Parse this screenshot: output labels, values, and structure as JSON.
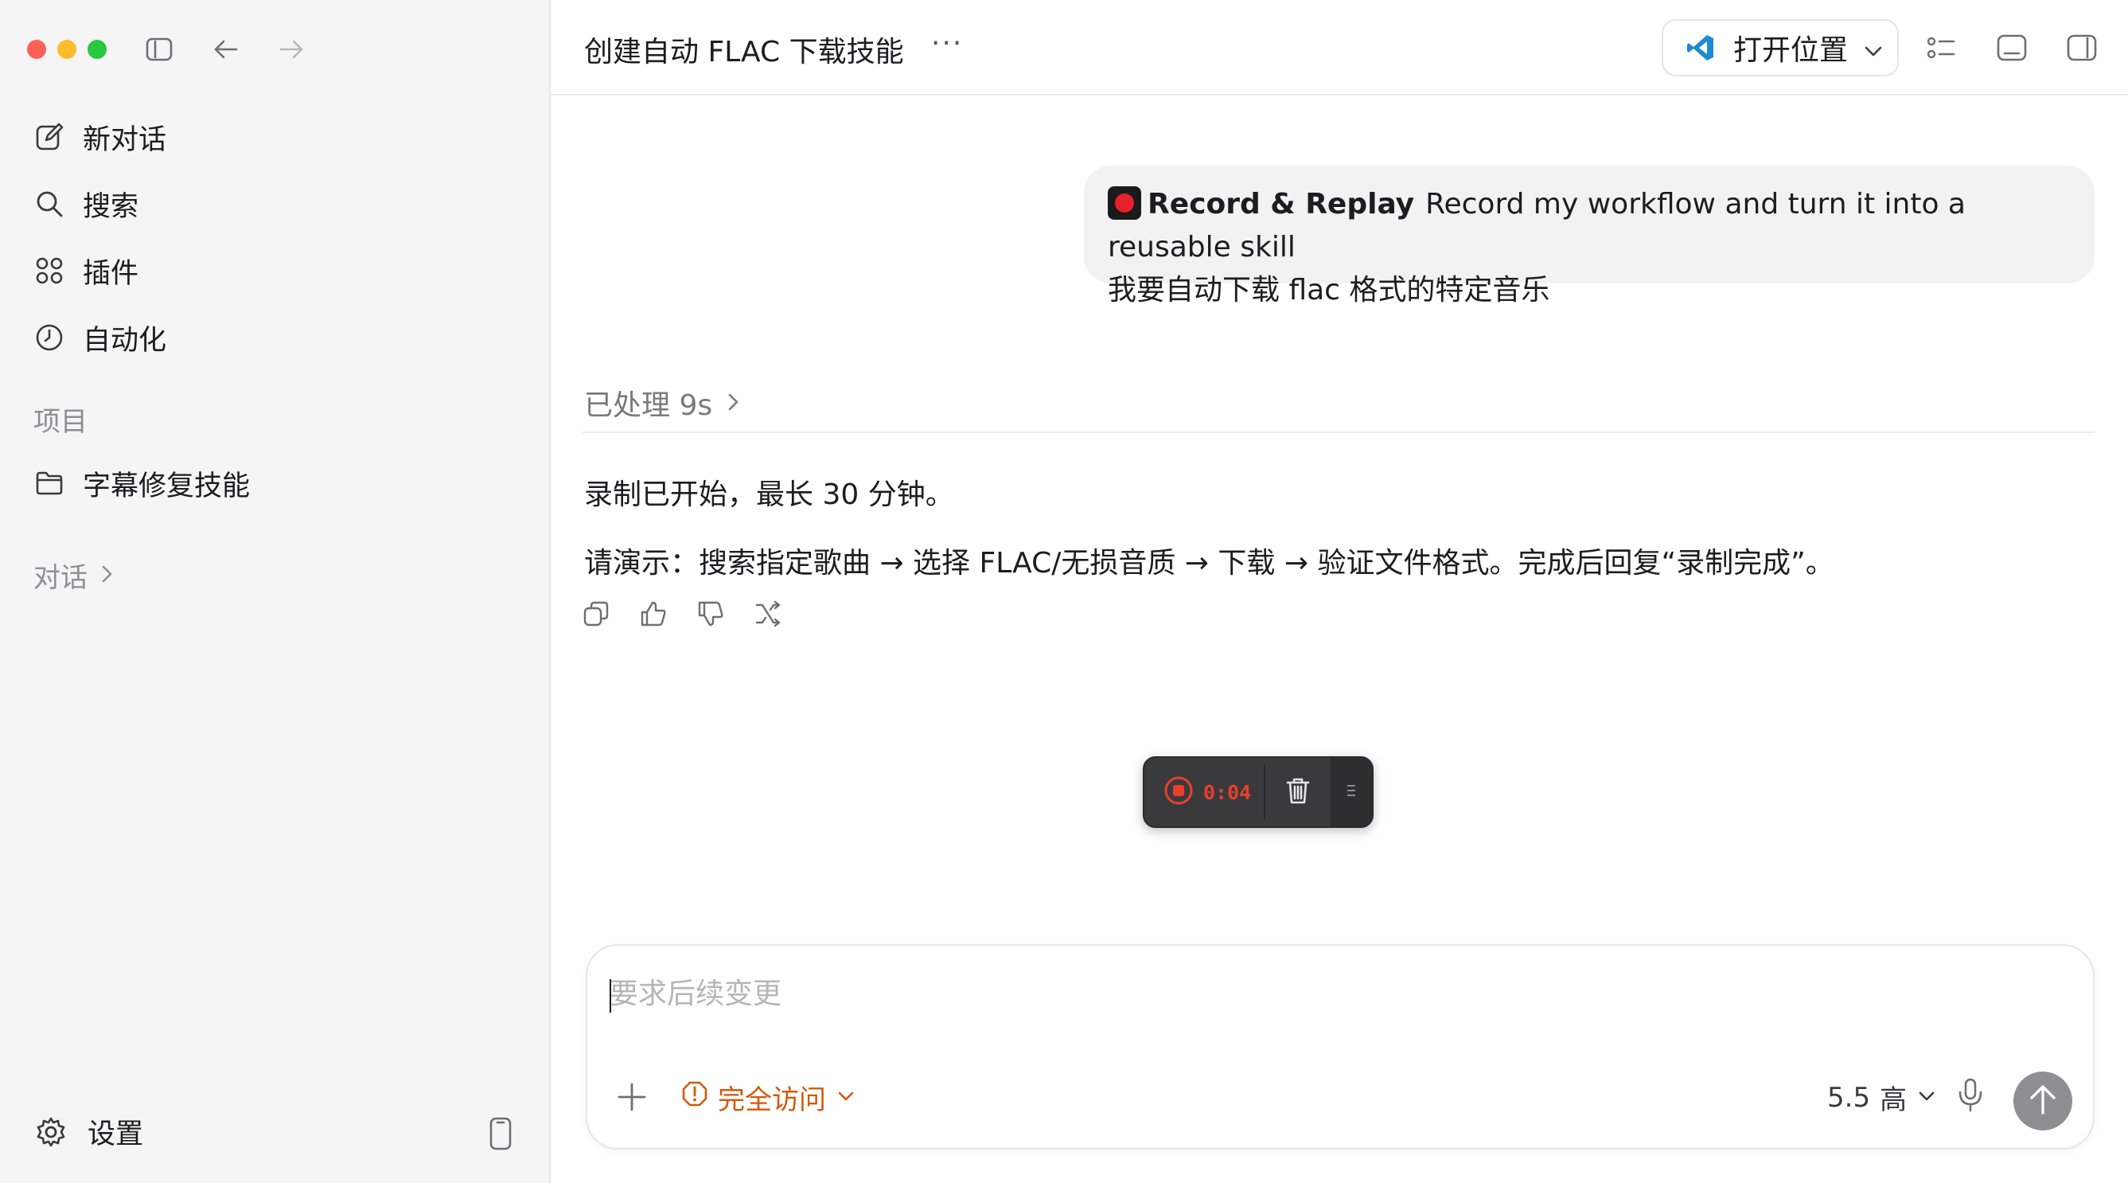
{
  "sidebar": {
    "nav": [
      {
        "label": "新对话",
        "icon": "edit-icon"
      },
      {
        "label": "搜索",
        "icon": "search-icon"
      },
      {
        "label": "插件",
        "icon": "plugins-icon"
      },
      {
        "label": "自动化",
        "icon": "clock-icon"
      }
    ],
    "projects_label": "项目",
    "projects": [
      {
        "label": "字幕修复技能",
        "icon": "folder-icon"
      }
    ],
    "conversations_label": "对话",
    "settings_label": "设置"
  },
  "header": {
    "title": "创建自动 FLAC 下载技能",
    "more": "···",
    "open_location": "打开位置"
  },
  "chat": {
    "user_message": {
      "skill_name": "Record & Replay",
      "skill_desc": "Record my workflow and turn it into a reusable skill",
      "text": "我要自动下载 flac 格式的特定音乐"
    },
    "processed": "已处理 9s",
    "reply": [
      "录制已开始，最长 30 分钟。",
      "请演示：搜索指定歌曲 → 选择 FLAC/无损音质 → 下载 → 验证文件格式。完成后回复“录制完成”。"
    ]
  },
  "recording": {
    "time": "0:04",
    "color": "#e8402d"
  },
  "composer": {
    "placeholder": "要求后续变更",
    "access_label": "完全访问",
    "model_version": "5.5",
    "model_effort": "高"
  },
  "colors": {
    "accent_orange": "#d4590a",
    "send_button": "#8e8e93",
    "sidebar_bg": "#f5f5f5"
  }
}
